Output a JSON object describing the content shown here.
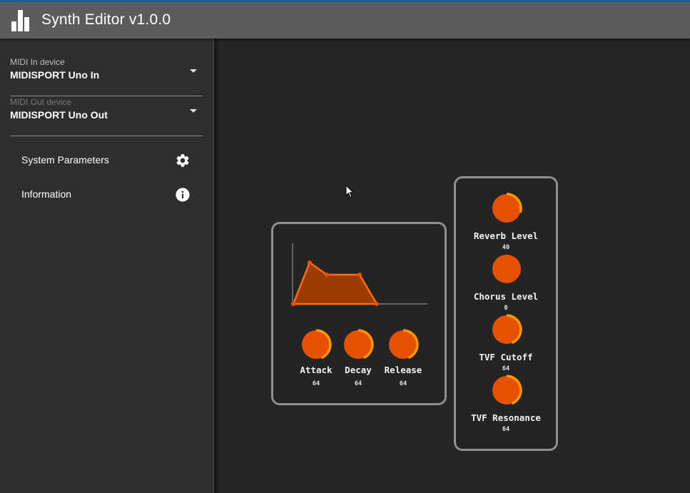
{
  "app": {
    "title": "Synth Editor v1.0.0",
    "logo_icon": "bar-chart-icon",
    "colors": {
      "accent": "#e65100",
      "arc": "#ff9800",
      "appbar": "#5c5c5c",
      "topstrip": "#1f5fb3"
    }
  },
  "sidebar": {
    "midi_in": {
      "label": "MIDI In device",
      "value": "MIDISPORT Uno In"
    },
    "midi_out": {
      "label": "MIDI Out device",
      "value": "MIDISPORT Uno Out"
    },
    "items": [
      {
        "label": "System Parameters",
        "icon": "gear-icon"
      },
      {
        "label": "Information",
        "icon": "info-icon"
      }
    ]
  },
  "envelope": {
    "knobs": [
      {
        "label": "Attack",
        "value": "64"
      },
      {
        "label": "Decay",
        "value": "64"
      },
      {
        "label": "Release",
        "value": "64"
      }
    ]
  },
  "effects": {
    "knobs": [
      {
        "label": "Reverb Level",
        "value": "40"
      },
      {
        "label": "Chorus Level",
        "value": "0"
      },
      {
        "label": "TVF Cutoff",
        "value": "64"
      },
      {
        "label": "TVF Resonance",
        "value": "64"
      }
    ]
  }
}
